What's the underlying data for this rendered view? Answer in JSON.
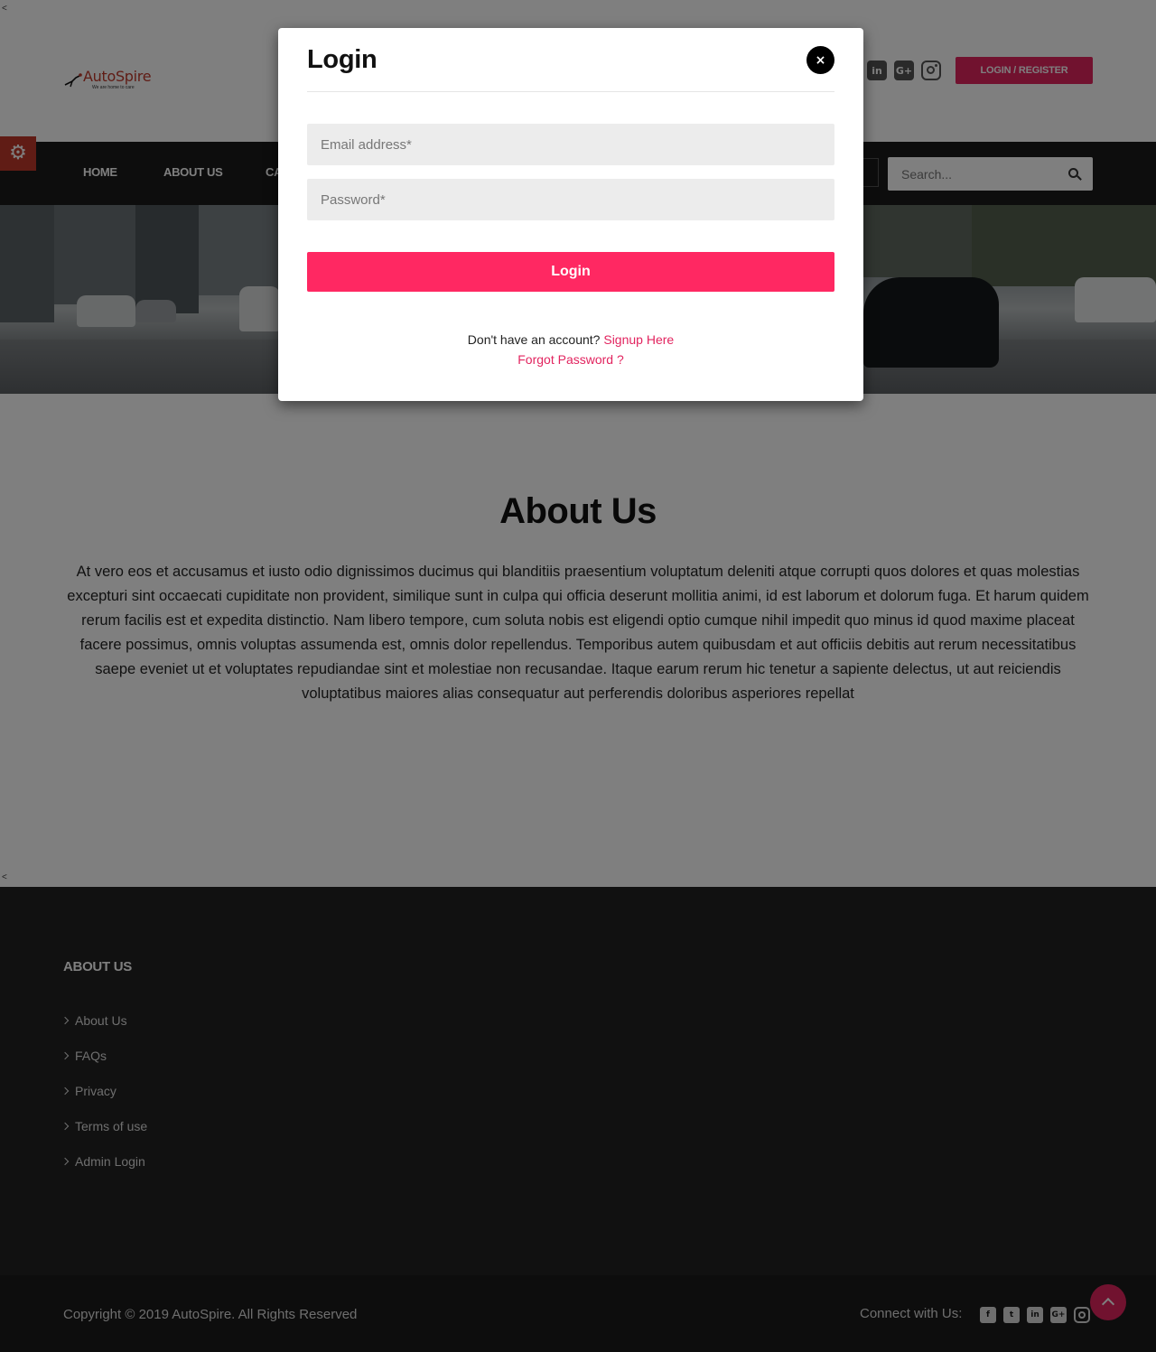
{
  "header": {
    "logo_name": "AutoSpire",
    "logo_tagline": "We are home to care",
    "social": [
      "linkedin-icon",
      "google-plus-icon",
      "instagram-icon"
    ],
    "login_register_label": "LOGIN / REGISTER"
  },
  "nav": {
    "items": [
      "HOME",
      "ABOUT US",
      "CA"
    ],
    "search_placeholder": "Search..."
  },
  "about": {
    "title": "About Us",
    "body": "At vero eos et accusamus et iusto odio dignissimos ducimus qui blanditiis praesentium voluptatum deleniti atque corrupti quos dolores et quas molestias excepturi sint occaecati cupiditate non provident, similique sunt in culpa qui officia deserunt mollitia animi, id est laborum et dolorum fuga. Et harum quidem rerum facilis est et expedita distinctio. Nam libero tempore, cum soluta nobis est eligendi optio cumque nihil impedit quo minus id quod maxime placeat facere possimus, omnis voluptas assumenda est, omnis dolor repellendus. Temporibus autem quibusdam et aut officiis debitis aut rerum necessitatibus saepe eveniet ut et voluptates repudiandae sint et molestiae non recusandae. Itaque earum rerum hic tenetur a sapiente delectus, ut aut reiciendis voluptatibus maiores alias consequatur aut perferendis doloribus asperiores repellat"
  },
  "footer": {
    "heading": "ABOUT US",
    "links": [
      "About Us",
      "FAQs",
      "Privacy",
      "Terms of use",
      "Admin Login"
    ],
    "copyright": "Copyright © 2019 AutoSpire. All Rights Reserved",
    "connect_label": "Connect with Us:",
    "social": [
      "facebook-icon",
      "twitter-icon",
      "linkedin-icon",
      "google-plus-icon",
      "instagram-icon"
    ]
  },
  "modal": {
    "title": "Login",
    "close_glyph": "×",
    "email_placeholder": "Email address*",
    "password_placeholder": "Password*",
    "login_button": "Login",
    "no_account_text": "Don't have an account?",
    "signup_link": "Signup Here",
    "forgot_link": "Forgot Password ?"
  },
  "stray_glyph": "<",
  "colors": {
    "accent": "#e2245f",
    "login_button": "#ff2862",
    "nav_bg": "#1b1b1b",
    "footer_bg": "#222222",
    "gear_bg": "#c0392b"
  }
}
